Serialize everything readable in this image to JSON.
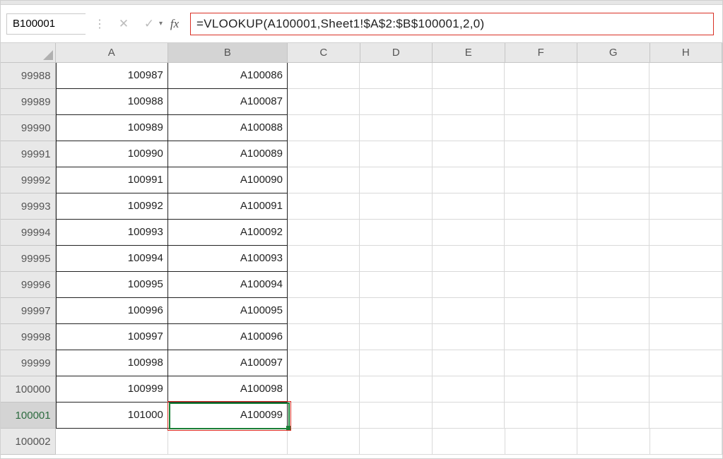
{
  "name_box": {
    "value": "B100001"
  },
  "formula_bar": {
    "cancel_icon": "✕",
    "confirm_icon": "✓",
    "fx_label": "fx",
    "formula": "=VLOOKUP(A100001,Sheet1!$A$2:$B$100001,2,0)"
  },
  "columns": [
    "A",
    "B",
    "C",
    "D",
    "E",
    "F",
    "G",
    "H"
  ],
  "col_widths": {
    "A": 160,
    "B": 170,
    "rest": 103
  },
  "selected_col": "B",
  "rows": [
    {
      "num": "99988",
      "A": "100987",
      "B": "A100086"
    },
    {
      "num": "99989",
      "A": "100988",
      "B": "A100087"
    },
    {
      "num": "99990",
      "A": "100989",
      "B": "A100088"
    },
    {
      "num": "99991",
      "A": "100990",
      "B": "A100089"
    },
    {
      "num": "99992",
      "A": "100991",
      "B": "A100090"
    },
    {
      "num": "99993",
      "A": "100992",
      "B": "A100091"
    },
    {
      "num": "99994",
      "A": "100993",
      "B": "A100092"
    },
    {
      "num": "99995",
      "A": "100994",
      "B": "A100093"
    },
    {
      "num": "99996",
      "A": "100995",
      "B": "A100094"
    },
    {
      "num": "99997",
      "A": "100996",
      "B": "A100095"
    },
    {
      "num": "99998",
      "A": "100997",
      "B": "A100096"
    },
    {
      "num": "99999",
      "A": "100998",
      "B": "A100097"
    },
    {
      "num": "100000",
      "A": "100999",
      "B": "A100098"
    },
    {
      "num": "100001",
      "A": "101000",
      "B": "A100099",
      "selected": true
    },
    {
      "num": "100002",
      "A": "",
      "B": ""
    }
  ],
  "active_cell": {
    "row": "100001",
    "col": "B"
  }
}
